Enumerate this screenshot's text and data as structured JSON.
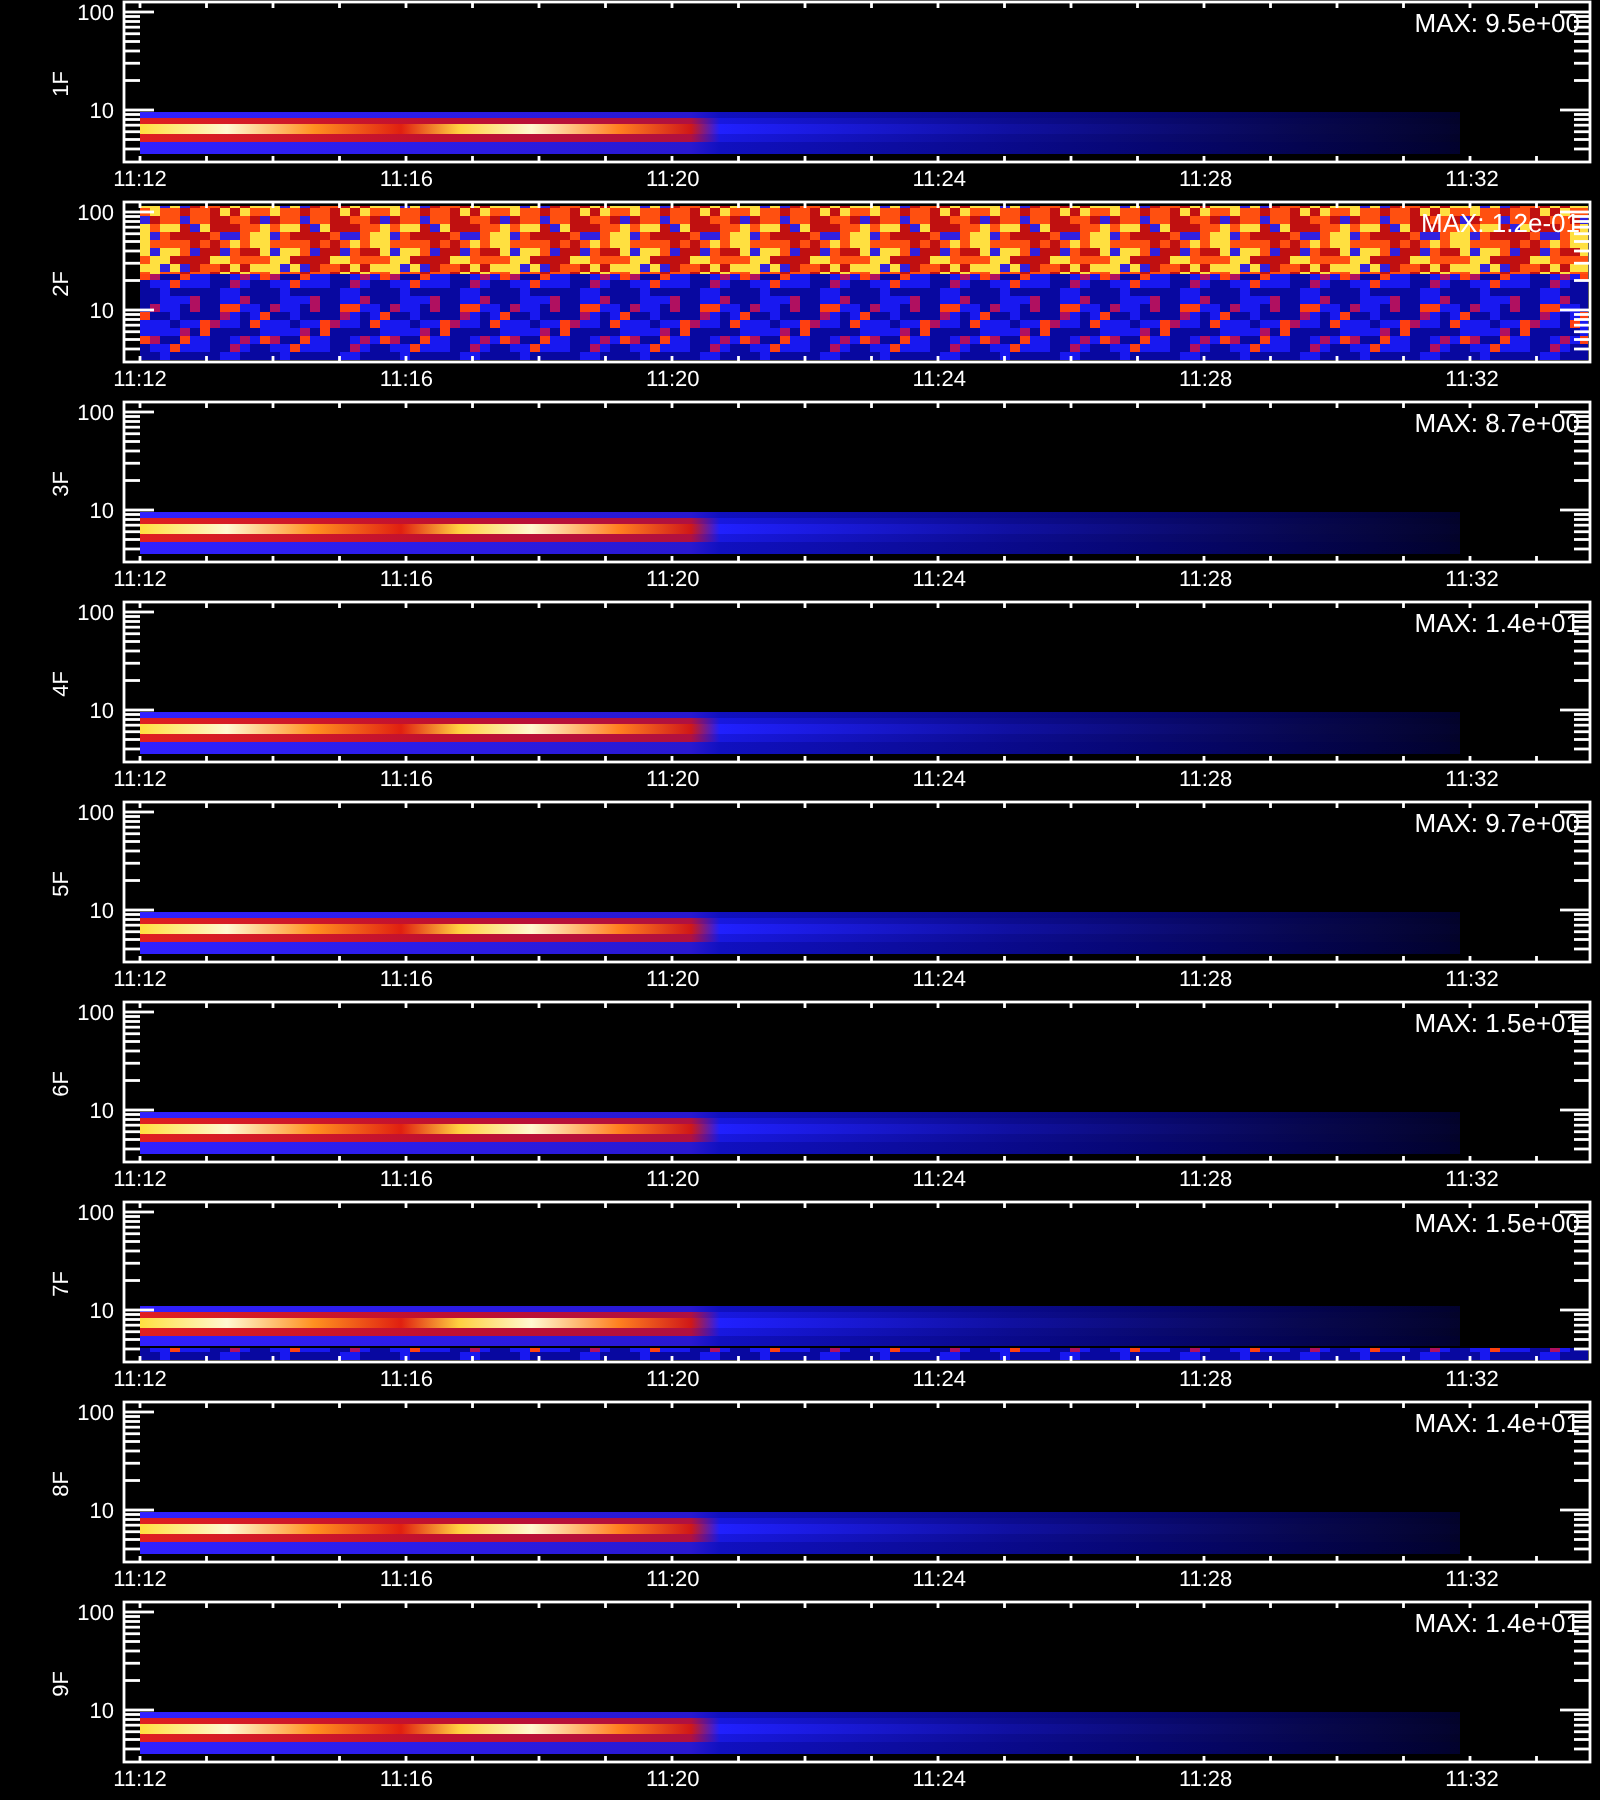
{
  "panels": [
    {
      "label": "1F",
      "max": "MAX: 9.5e+00",
      "kind": "band",
      "y_ticks": [
        "100",
        "10"
      ],
      "x_ticks": [
        "11:12",
        "11:16",
        "11:20",
        "11:24",
        "11:28",
        "11:32"
      ]
    },
    {
      "label": "2F",
      "max": "MAX: 1.2e-01",
      "kind": "noise",
      "y_ticks": [
        "100",
        "10"
      ],
      "x_ticks": [
        "11:12",
        "11:16",
        "11:20",
        "11:24",
        "11:28",
        "11:32"
      ]
    },
    {
      "label": "3F",
      "max": "MAX: 8.7e+00",
      "kind": "band",
      "y_ticks": [
        "100",
        "10"
      ],
      "x_ticks": [
        "11:12",
        "11:16",
        "11:20",
        "11:24",
        "11:28",
        "11:32"
      ]
    },
    {
      "label": "4F",
      "max": "MAX: 1.4e+01",
      "kind": "band",
      "y_ticks": [
        "100",
        "10"
      ],
      "x_ticks": [
        "11:12",
        "11:16",
        "11:20",
        "11:24",
        "11:28",
        "11:32"
      ]
    },
    {
      "label": "5F",
      "max": "MAX: 9.7e+00",
      "kind": "band",
      "y_ticks": [
        "100",
        "10"
      ],
      "x_ticks": [
        "11:12",
        "11:16",
        "11:20",
        "11:24",
        "11:28",
        "11:32"
      ]
    },
    {
      "label": "6F",
      "max": "MAX: 1.5e+01",
      "kind": "band",
      "y_ticks": [
        "100",
        "10"
      ],
      "x_ticks": [
        "11:12",
        "11:16",
        "11:20",
        "11:24",
        "11:28",
        "11:32"
      ]
    },
    {
      "label": "7F",
      "max": "MAX: 1.5e+00",
      "kind": "floor",
      "y_ticks": [
        "100",
        "10"
      ],
      "x_ticks": [
        "11:12",
        "11:16",
        "11:20",
        "11:24",
        "11:28",
        "11:32"
      ]
    },
    {
      "label": "8F",
      "max": "MAX: 1.4e+01",
      "kind": "band",
      "y_ticks": [
        "100",
        "10"
      ],
      "x_ticks": [
        "11:12",
        "11:16",
        "11:20",
        "11:24",
        "11:28",
        "11:32"
      ]
    },
    {
      "label": "9F",
      "max": "MAX: 1.4e+01",
      "kind": "band",
      "y_ticks": [
        "100",
        "10"
      ],
      "x_ticks": [
        "11:12",
        "11:16",
        "11:20",
        "11:24",
        "11:28",
        "11:32"
      ]
    }
  ]
}
